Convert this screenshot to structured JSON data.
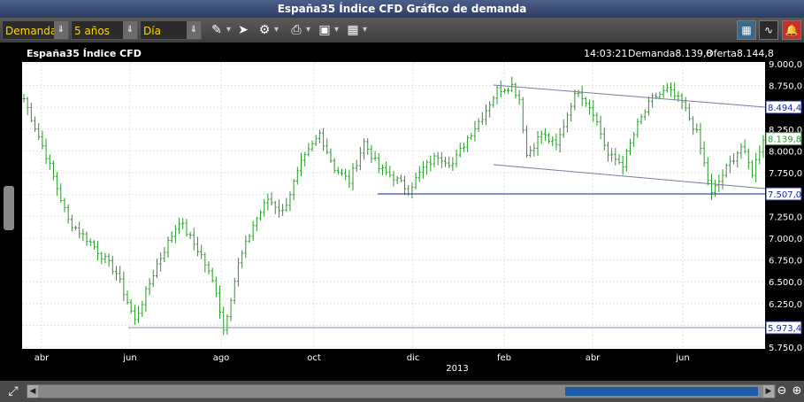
{
  "window": {
    "title": "España35 Índice CFD Gráfico de demanda"
  },
  "toolbar": {
    "price_type": "Demanda",
    "period": "5 años",
    "interval": "Día"
  },
  "chart_header": {
    "instrument": "España35 Índice CFD",
    "time": "14:03:21",
    "bid": "Demanda8.139,8",
    "ask": "Oferta8.144,8"
  },
  "chart_data": {
    "type": "ohlc",
    "series_color": "#2a9a2a",
    "x_tick_labels": [
      "abr",
      "jun",
      "ago",
      "oct",
      "dic",
      "feb",
      "abr",
      "jun"
    ],
    "year_label": "2013",
    "y_tick_labels": [
      "9.000,0",
      "8.750,0",
      "8.500,0",
      "8.250,0",
      "8.000,0",
      "7.750,0",
      "7.500,0",
      "7.250,0",
      "7.000,0",
      "6.750,0",
      "6.500,0",
      "6.250,0",
      "6.000,0",
      "5.750,0"
    ],
    "y_ticks": [
      9000,
      8750,
      8500,
      8250,
      8000,
      7750,
      7500,
      7250,
      7000,
      6750,
      6500,
      6250,
      6000,
      5750
    ],
    "ylim": [
      5750,
      9000
    ],
    "markers": [
      {
        "label": "8.494,4",
        "value": 8494.4,
        "color": "#1a2a9a"
      },
      {
        "label": "8.139,8",
        "value": 8139.8,
        "color": "#2a9a2a"
      },
      {
        "label": "7.507,0",
        "value": 7507.0,
        "color": "#1a2a9a"
      },
      {
        "label": "5.973,4",
        "value": 5973.4,
        "color": "#1a2a9a"
      }
    ],
    "key_points": [
      [
        0,
        8600
      ],
      [
        6,
        7950
      ],
      [
        12,
        7200
      ],
      [
        18,
        6950
      ],
      [
        25,
        6600
      ],
      [
        30,
        6050
      ],
      [
        36,
        6700
      ],
      [
        42,
        7200
      ],
      [
        48,
        6800
      ],
      [
        52,
        6400
      ],
      [
        54,
        5950
      ],
      [
        58,
        6700
      ],
      [
        62,
        7150
      ],
      [
        66,
        7450
      ],
      [
        70,
        7300
      ],
      [
        75,
        7850
      ],
      [
        80,
        8200
      ],
      [
        84,
        7800
      ],
      [
        88,
        7650
      ],
      [
        92,
        8100
      ],
      [
        96,
        7800
      ],
      [
        100,
        7700
      ],
      [
        104,
        7550
      ],
      [
        108,
        7800
      ],
      [
        112,
        7950
      ],
      [
        116,
        7850
      ],
      [
        120,
        8150
      ],
      [
        124,
        8400
      ],
      [
        128,
        8700
      ],
      [
        132,
        8750
      ],
      [
        134,
        8600
      ],
      [
        136,
        7950
      ],
      [
        140,
        8200
      ],
      [
        144,
        8050
      ],
      [
        148,
        8550
      ],
      [
        150,
        8700
      ],
      [
        154,
        8450
      ],
      [
        158,
        7950
      ],
      [
        162,
        7850
      ],
      [
        166,
        8300
      ],
      [
        170,
        8600
      ],
      [
        174,
        8700
      ],
      [
        178,
        8550
      ],
      [
        182,
        8200
      ],
      [
        186,
        7500
      ],
      [
        190,
        7800
      ],
      [
        194,
        8050
      ],
      [
        197,
        7750
      ],
      [
        200,
        8150
      ]
    ],
    "n_bars": 201
  },
  "icons": {
    "toolbar": [
      "pencil-icon",
      "pin-icon",
      "tools-icon",
      "print-icon",
      "image-icon",
      "grid-icon"
    ],
    "right": [
      "layout-icon",
      "chart-icon",
      "alert-icon"
    ],
    "bottom": [
      "fullscreen-icon",
      "zoom-out-icon",
      "zoom-in-icon"
    ]
  }
}
